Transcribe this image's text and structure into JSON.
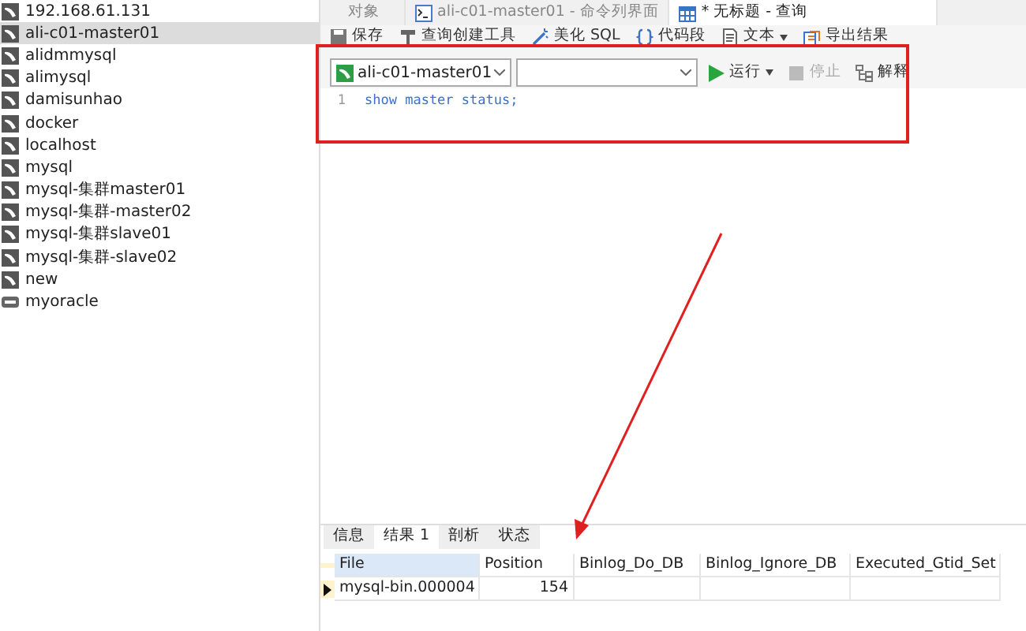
{
  "sidebar": {
    "items": [
      {
        "label": "192.168.61.131",
        "kind": "mysql",
        "selected": false
      },
      {
        "label": "ali-c01-master01",
        "kind": "mysql",
        "selected": true
      },
      {
        "label": "alidmmysql",
        "kind": "mysql",
        "selected": false
      },
      {
        "label": "alimysql",
        "kind": "mysql",
        "selected": false
      },
      {
        "label": "damisunhao",
        "kind": "mysql",
        "selected": false
      },
      {
        "label": "docker",
        "kind": "mysql",
        "selected": false
      },
      {
        "label": "localhost",
        "kind": "mysql",
        "selected": false
      },
      {
        "label": "mysql",
        "kind": "mysql",
        "selected": false
      },
      {
        "label": "mysql-集群master01",
        "kind": "mysql",
        "selected": false
      },
      {
        "label": "mysql-集群-master02",
        "kind": "mysql",
        "selected": false
      },
      {
        "label": "mysql-集群slave01",
        "kind": "mysql",
        "selected": false
      },
      {
        "label": "mysql-集群-slave02",
        "kind": "mysql",
        "selected": false
      },
      {
        "label": "new",
        "kind": "mysql",
        "selected": false
      },
      {
        "label": "myoracle",
        "kind": "oracle",
        "selected": false
      }
    ]
  },
  "tabs": [
    {
      "label": "对象",
      "kind": "plain",
      "selected": false
    },
    {
      "label": "ali-c01-master01 - 命令列界面",
      "kind": "console",
      "selected": false
    },
    {
      "label": "* 无标题 - 查询",
      "kind": "query",
      "selected": true
    }
  ],
  "toolbar": [
    {
      "label": "保存",
      "kind": "save",
      "dropdown": false
    },
    {
      "label": "查询创建工具",
      "kind": "builder",
      "dropdown": false
    },
    {
      "label": "美化 SQL",
      "kind": "beautify",
      "dropdown": false
    },
    {
      "label": "代码段",
      "kind": "snippet",
      "dropdown": false
    },
    {
      "label": "文本",
      "kind": "text",
      "dropdown": true
    },
    {
      "label": "导出结果",
      "kind": "export",
      "dropdown": false
    }
  ],
  "selectors": {
    "connection": "ali-c01-master01"
  },
  "actions": [
    {
      "label": "运行",
      "kind": "run",
      "disabled": false,
      "dropdown": true
    },
    {
      "label": "停止",
      "kind": "stop",
      "disabled": true,
      "dropdown": false
    },
    {
      "label": "解释",
      "kind": "explain",
      "disabled": false,
      "dropdown": false
    }
  ],
  "editor": {
    "lines": [
      {
        "number": "1",
        "code": "show master status;"
      }
    ]
  },
  "result_tabs": [
    {
      "label": "信息",
      "selected": false
    },
    {
      "label": "结果 1",
      "selected": true
    },
    {
      "label": "剖析",
      "selected": false
    },
    {
      "label": "状态",
      "selected": false
    }
  ],
  "table": {
    "columns": [
      {
        "label": "File",
        "selected": true
      },
      {
        "label": "Position",
        "selected": false
      },
      {
        "label": "Binlog_Do_DB",
        "selected": false
      },
      {
        "label": "Binlog_Ignore_DB",
        "selected": false
      },
      {
        "label": "Executed_Gtid_Set",
        "selected": false
      }
    ],
    "rows": [
      {
        "current": true,
        "cells": [
          "mysql-bin.000004",
          "154",
          "",
          "",
          ""
        ]
      }
    ]
  }
}
